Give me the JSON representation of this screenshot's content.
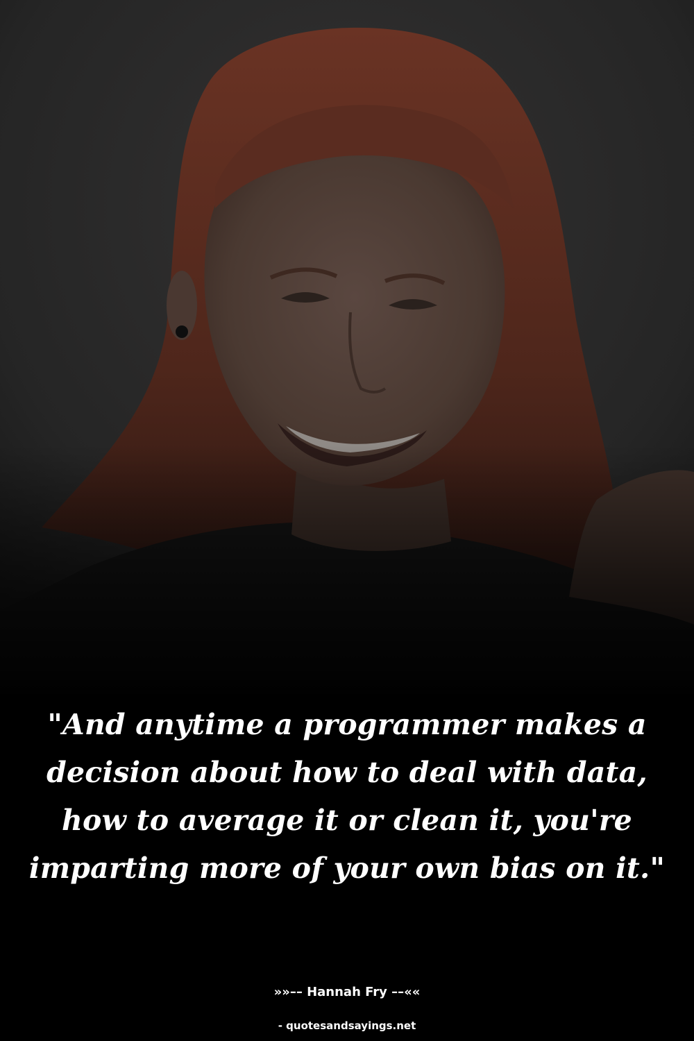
{
  "quote": {
    "text": "\"And anytime a programmer makes a decision about how to deal with data, how to average it or clean it, you're imparting more of your own bias on it.\""
  },
  "attribution": {
    "author_line": "»»–– Hannah Fry ––««",
    "source": "- quotesandsayings.net"
  },
  "photo": {
    "subject": "smiling woman with long auburn hair, darkened background",
    "colors": {
      "background": "#2b2b2b",
      "hair": "#5a2f22",
      "skin": "#4a3a33",
      "shirt": "#141414"
    }
  }
}
